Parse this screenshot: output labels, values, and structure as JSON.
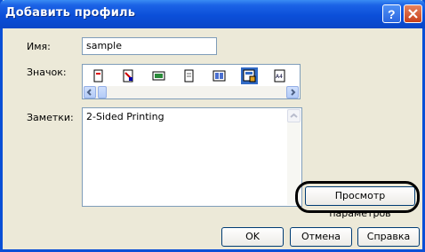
{
  "window": {
    "title": "Добавить профиль"
  },
  "labels": {
    "name": "Имя:",
    "icon": "Значок:",
    "notes": "Заметки:"
  },
  "name_field": {
    "value": "sample"
  },
  "icons": [
    "profile-icon-1",
    "profile-icon-2",
    "profile-icon-3",
    "profile-icon-4",
    "profile-icon-5",
    "profile-icon-6",
    "profile-icon-7"
  ],
  "selected_icon_index": 5,
  "notes_field": {
    "value": "2-Sided Printing"
  },
  "buttons": {
    "view_settings": "Просмотр параметров",
    "ok": "OK",
    "cancel": "Отмена",
    "help": "Справка"
  },
  "colors": {
    "title_bar": "#0a4fd6",
    "selection": "#316ac5",
    "dialog_bg": "#ece9d8"
  }
}
